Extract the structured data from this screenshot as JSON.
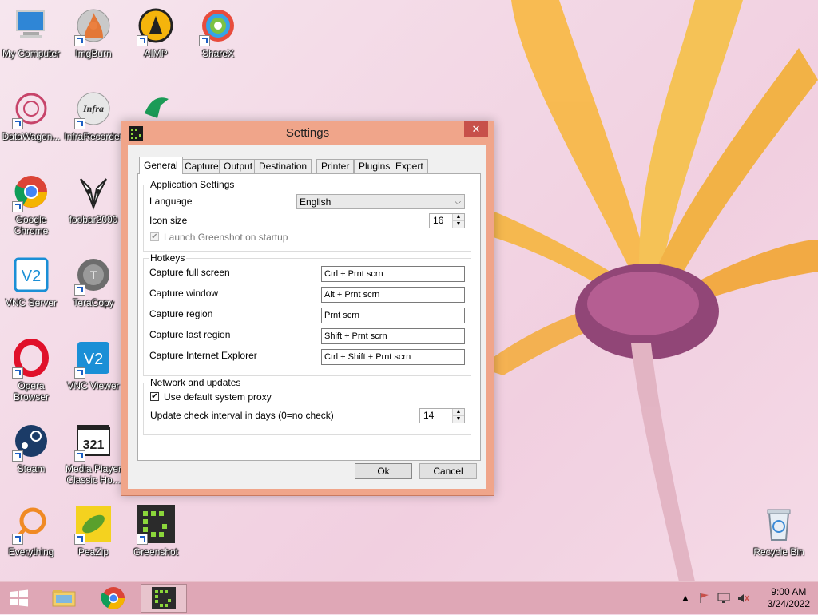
{
  "desktop": {
    "icons": [
      {
        "label": "My Computer",
        "icon": "computer-icon"
      },
      {
        "label": "ImgBurn",
        "icon": "disc-burn-icon"
      },
      {
        "label": "AIMP",
        "icon": "aimp-icon"
      },
      {
        "label": "ShareX",
        "icon": "sharex-icon"
      },
      {
        "label": "DataWagon...",
        "icon": "datawagon-icon"
      },
      {
        "label": "InfraRecorder",
        "icon": "infrarecorder-icon"
      },
      {
        "label": "Google Chrome",
        "icon": "chrome-icon"
      },
      {
        "label": "foobar2000",
        "icon": "foobar-icon"
      },
      {
        "label": "VNC Server",
        "icon": "vnc-icon"
      },
      {
        "label": "TeraCopy",
        "icon": "teracopy-icon"
      },
      {
        "label": "Opera Browser",
        "icon": "opera-icon"
      },
      {
        "label": "VNC Viewer",
        "icon": "vnc-icon"
      },
      {
        "label": "Steam",
        "icon": "steam-icon"
      },
      {
        "label": "Media Player Classic Ho...",
        "icon": "mpc-icon"
      },
      {
        "label": "Everything",
        "icon": "everything-icon"
      },
      {
        "label": "PeaZip",
        "icon": "peazip-icon"
      },
      {
        "label": "Greenshot",
        "icon": "greenshot-icon"
      },
      {
        "label": "Recycle Bin",
        "icon": "recycle-bin-icon"
      }
    ]
  },
  "window": {
    "title": "Settings",
    "close_glyph": "✕",
    "tabs": [
      "General",
      "Capture",
      "Output",
      "Destination",
      "Printer",
      "Plugins",
      "Expert"
    ],
    "app_settings": {
      "title": "Application Settings",
      "language_label": "Language",
      "language_value": "English",
      "icon_size_label": "Icon size",
      "icon_size_value": "16",
      "launch_label": "Launch Greenshot on startup",
      "launch_checked": true
    },
    "hotkeys": {
      "title": "Hotkeys",
      "rows": [
        {
          "label": "Capture full screen",
          "value": "Ctrl + Prnt scrn"
        },
        {
          "label": "Capture window",
          "value": "Alt + Prnt scrn"
        },
        {
          "label": "Capture region",
          "value": "Prnt scrn"
        },
        {
          "label": "Capture last region",
          "value": "Shift + Prnt scrn"
        },
        {
          "label": "Capture Internet Explorer",
          "value": "Ctrl + Shift + Prnt scrn"
        }
      ]
    },
    "network": {
      "title": "Network and updates",
      "proxy_label": "Use default system proxy",
      "proxy_checked": true,
      "interval_label": "Update check interval in days (0=no check)",
      "interval_value": "14"
    },
    "ok_label": "Ok",
    "cancel_label": "Cancel"
  },
  "taskbar": {
    "time": "9:00 AM",
    "date": "3/24/2022"
  },
  "colors": {
    "window_frame": "#f0a58a",
    "close_button": "#c7504a",
    "taskbar": "#dfa7b6"
  }
}
